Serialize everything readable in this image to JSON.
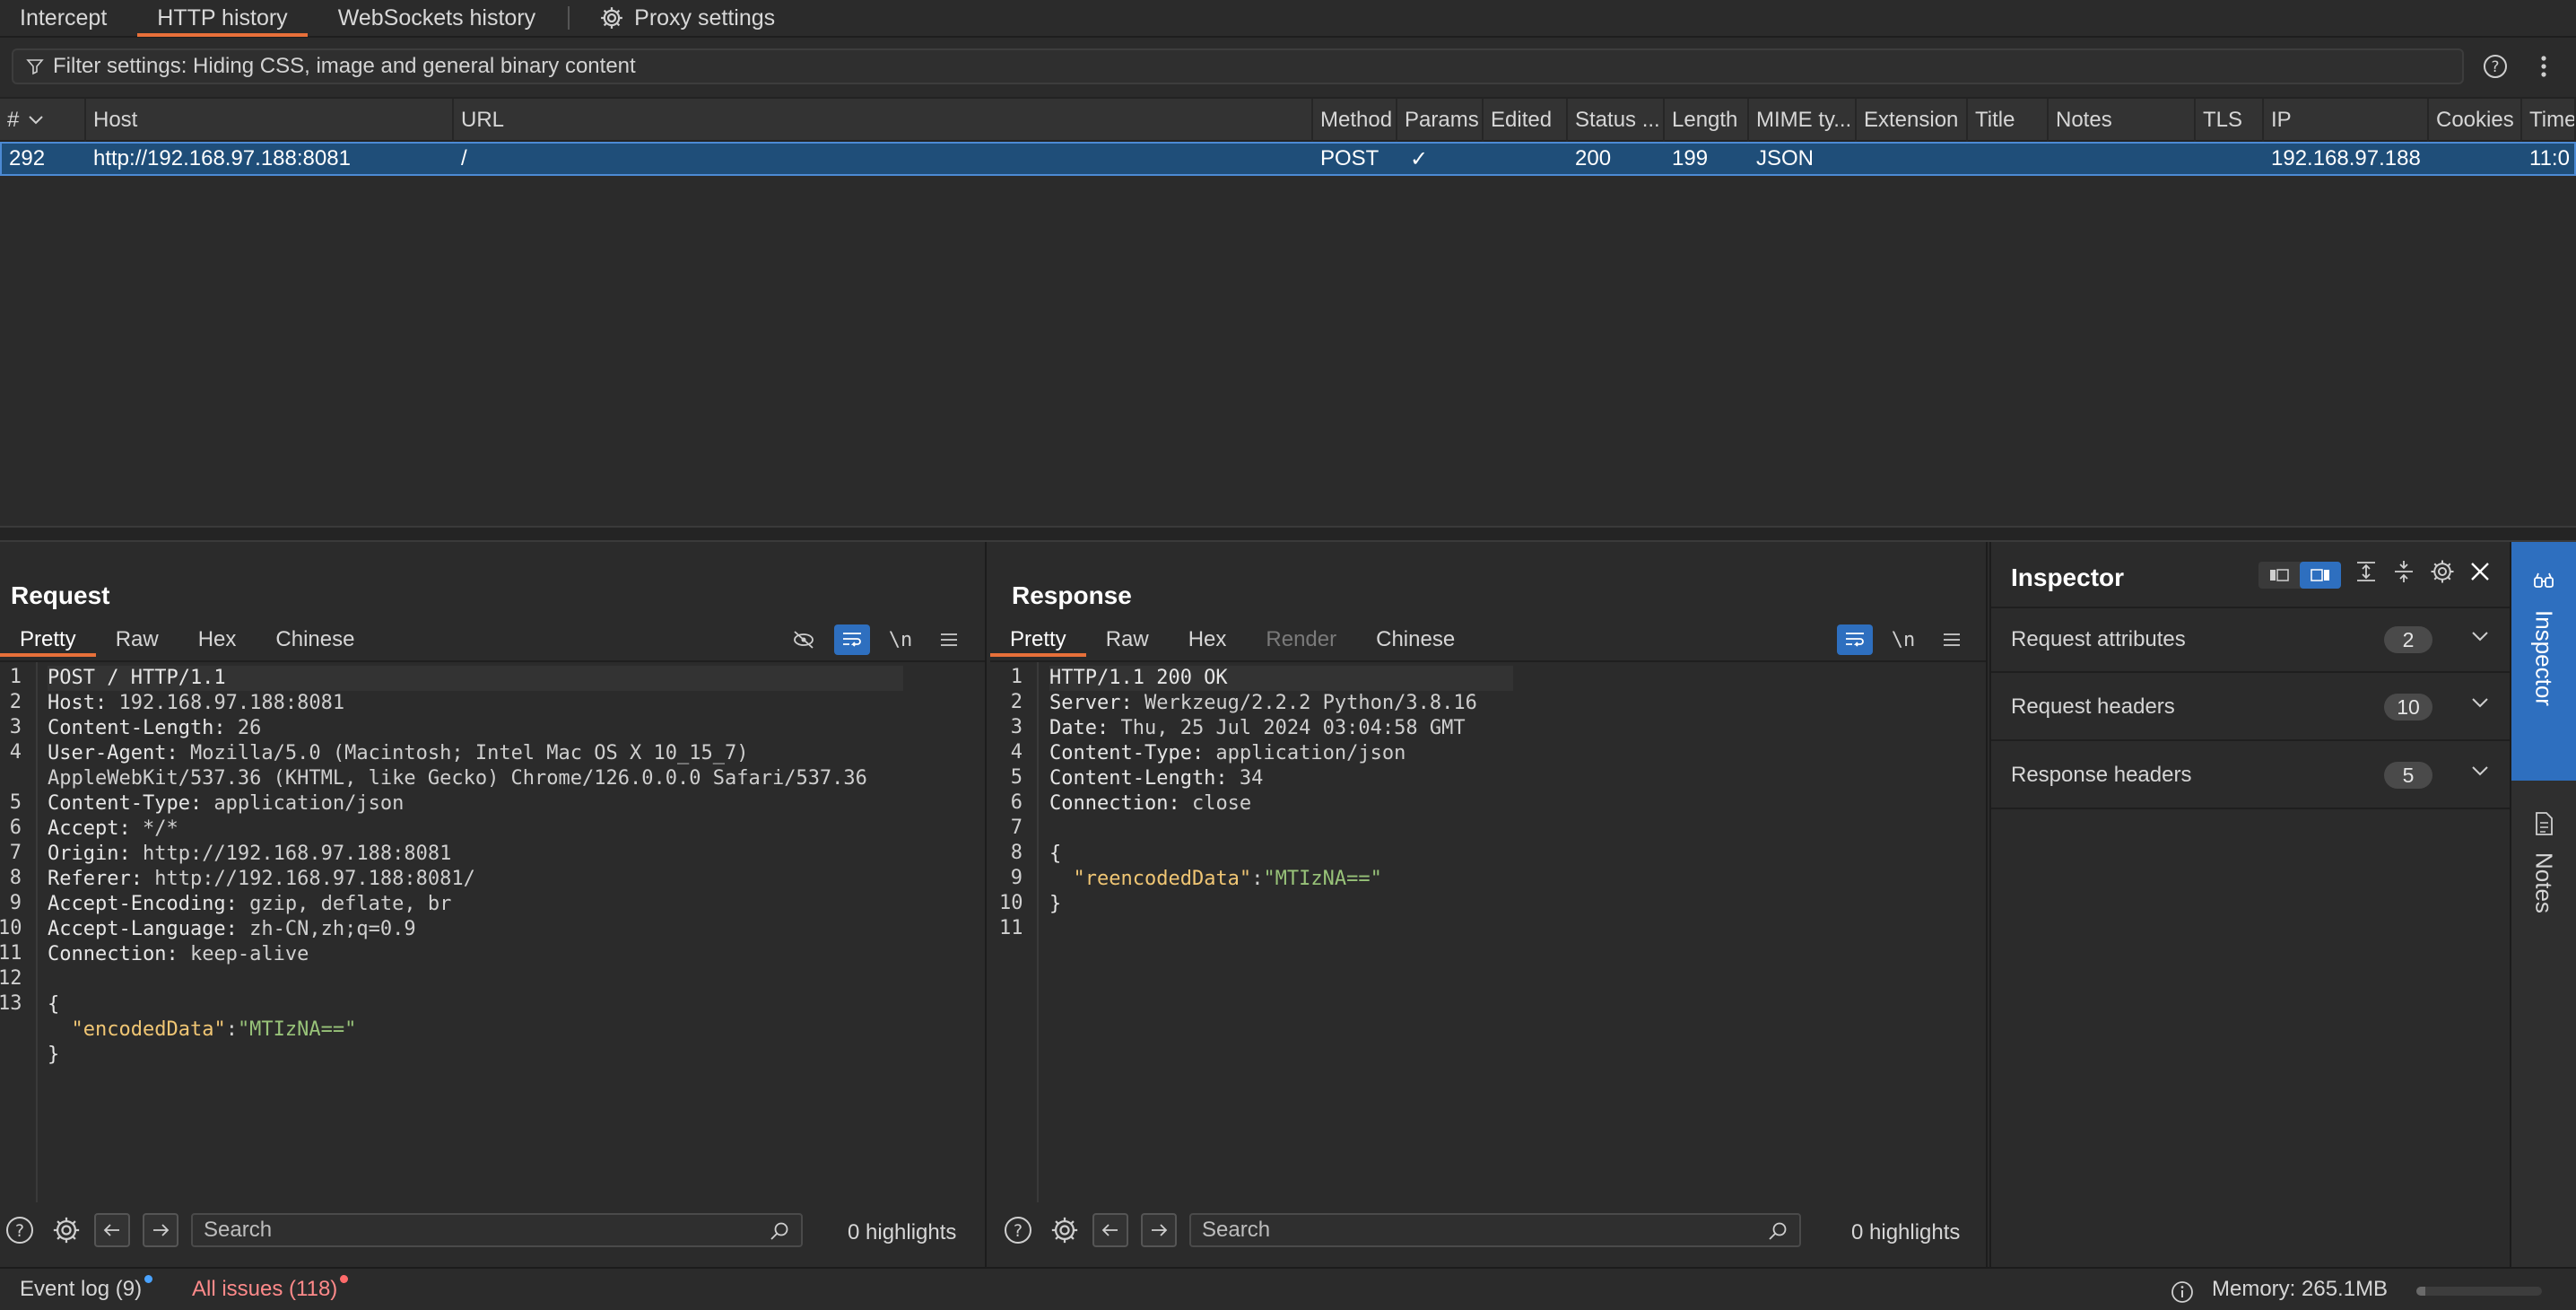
{
  "top_tabs": [
    {
      "label": "Intercept",
      "active": false
    },
    {
      "label": "HTTP history",
      "active": true
    },
    {
      "label": "WebSockets history",
      "active": false
    }
  ],
  "proxy_settings_label": "Proxy settings",
  "filter": {
    "text": "Filter settings: Hiding CSS, image and general binary content"
  },
  "table": {
    "columns": [
      "#",
      "Host",
      "URL",
      "Method",
      "Params",
      "Edited",
      "Status ...",
      "Length",
      "MIME ty...",
      "Extension",
      "Title",
      "Notes",
      "TLS",
      "IP",
      "Cookies",
      "Time"
    ],
    "rows": [
      {
        "num": "292",
        "host": "http://192.168.97.188:8081",
        "url": "/",
        "method": "POST",
        "params": "✓",
        "edited": "",
        "status": "200",
        "length": "199",
        "mime": "JSON",
        "extension": "",
        "title": "",
        "notes": "",
        "tls": "",
        "ip": "192.168.97.188",
        "cookies": "",
        "time": "11:0"
      }
    ]
  },
  "request": {
    "title": "Request",
    "tabs": [
      "Pretty",
      "Raw",
      "Hex",
      "Chinese"
    ],
    "lines": [
      {
        "n": "1",
        "key": "POST / HTTP/1.1",
        "val": ""
      },
      {
        "n": "2",
        "key": "Host:",
        "val": " 192.168.97.188:8081"
      },
      {
        "n": "3",
        "key": "Content-Length:",
        "val": " 26"
      },
      {
        "n": "4",
        "key": "User-Agent:",
        "val": " Mozilla/5.0 (Macintosh; Intel Mac OS X 10_15_7)"
      },
      {
        "n": "",
        "key": "",
        "val": "AppleWebKit/537.36 (KHTML, like Gecko) Chrome/126.0.0.0 Safari/537.36"
      },
      {
        "n": "5",
        "key": "Content-Type:",
        "val": " application/json"
      },
      {
        "n": "6",
        "key": "Accept:",
        "val": " */*"
      },
      {
        "n": "7",
        "key": "Origin:",
        "val": " http://192.168.97.188:8081"
      },
      {
        "n": "8",
        "key": "Referer:",
        "val": " http://192.168.97.188:8081/"
      },
      {
        "n": "9",
        "key": "Accept-Encoding:",
        "val": " gzip, deflate, br"
      },
      {
        "n": "10",
        "key": "Accept-Language:",
        "val": " zh-CN,zh;q=0.9"
      },
      {
        "n": "11",
        "key": "Connection:",
        "val": " keep-alive"
      },
      {
        "n": "12",
        "key": "",
        "val": ""
      },
      {
        "n": "13",
        "key": "{",
        "val": ""
      }
    ],
    "json_key": "\"encodedData\"",
    "json_val": "\"MTIzNA==\"",
    "json_close": "}",
    "search_placeholder": "Search",
    "highlights": "0 highlights"
  },
  "response": {
    "title": "Response",
    "tabs": [
      "Pretty",
      "Raw",
      "Hex",
      "Render",
      "Chinese"
    ],
    "lines": [
      {
        "n": "1",
        "key": "HTTP/1.1 200 OK",
        "val": ""
      },
      {
        "n": "2",
        "key": "Server:",
        "val": " Werkzeug/2.2.2 Python/3.8.16"
      },
      {
        "n": "3",
        "key": "Date:",
        "val": " Thu, 25 Jul 2024 03:04:58 GMT"
      },
      {
        "n": "4",
        "key": "Content-Type:",
        "val": " application/json"
      },
      {
        "n": "5",
        "key": "Content-Length:",
        "val": " 34"
      },
      {
        "n": "6",
        "key": "Connection:",
        "val": " close"
      },
      {
        "n": "7",
        "key": "",
        "val": ""
      },
      {
        "n": "8",
        "key": "{",
        "val": ""
      }
    ],
    "json_line_num": "9",
    "json_key": "\"reencodedData\"",
    "json_val": "\"MTIzNA==\"",
    "json_close_num": "10",
    "json_close": "}",
    "last_num": "11",
    "search_placeholder": "Search",
    "highlights": "0 highlights"
  },
  "inspector": {
    "title": "Inspector",
    "sections": [
      {
        "label": "Request attributes",
        "count": "2"
      },
      {
        "label": "Request headers",
        "count": "10"
      },
      {
        "label": "Response headers",
        "count": "5"
      }
    ]
  },
  "rail": {
    "inspector": "Inspector",
    "notes": "Notes"
  },
  "status": {
    "event_log": "Event log (9)",
    "issues": "All issues (118)",
    "memory": "Memory: 265.1MB",
    "memory_fraction": 0.07
  },
  "colors": {
    "accent": "#e8703a",
    "selected": "#1f4e79",
    "blue": "#2e6fbf",
    "issues": "#ff8a8a",
    "json_key": "#f0c674",
    "json_val": "#98c379"
  }
}
